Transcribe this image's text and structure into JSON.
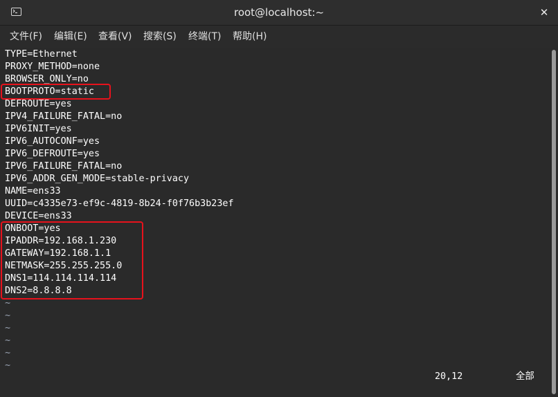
{
  "window": {
    "title": "root@localhost:~",
    "close_symbol": "✕",
    "icon": "terminal-icon"
  },
  "menu": [
    {
      "label": "文件(F)"
    },
    {
      "label": "编辑(E)"
    },
    {
      "label": "查看(V)"
    },
    {
      "label": "搜索(S)"
    },
    {
      "label": "终端(T)"
    },
    {
      "label": "帮助(H)"
    }
  ],
  "lines": [
    "TYPE=Ethernet",
    "PROXY_METHOD=none",
    "BROWSER_ONLY=no",
    "BOOTPROTO=static",
    "DEFROUTE=yes",
    "IPV4_FAILURE_FATAL=no",
    "IPV6INIT=yes",
    "IPV6_AUTOCONF=yes",
    "IPV6_DEFROUTE=yes",
    "IPV6_FAILURE_FATAL=no",
    "IPV6_ADDR_GEN_MODE=stable-privacy",
    "NAME=ens33",
    "UUID=c4335e73-ef9c-4819-8b24-f0f76b3b23ef",
    "DEVICE=ens33",
    "ONBOOT=yes",
    "IPADDR=192.168.1.230",
    "GATEWAY=192.168.1.1",
    "NETMASK=255.255.255.0",
    "DNS1=114.114.114.114",
    "DNS2=8.8.8.8"
  ],
  "tildes": [
    "~",
    "~",
    "~",
    "~",
    "~",
    "~"
  ],
  "status": {
    "position": "20,12",
    "scroll": "全部"
  },
  "colors": {
    "highlight": "#e8121c",
    "background": "#2a2a2a",
    "text": "#ffffff"
  }
}
